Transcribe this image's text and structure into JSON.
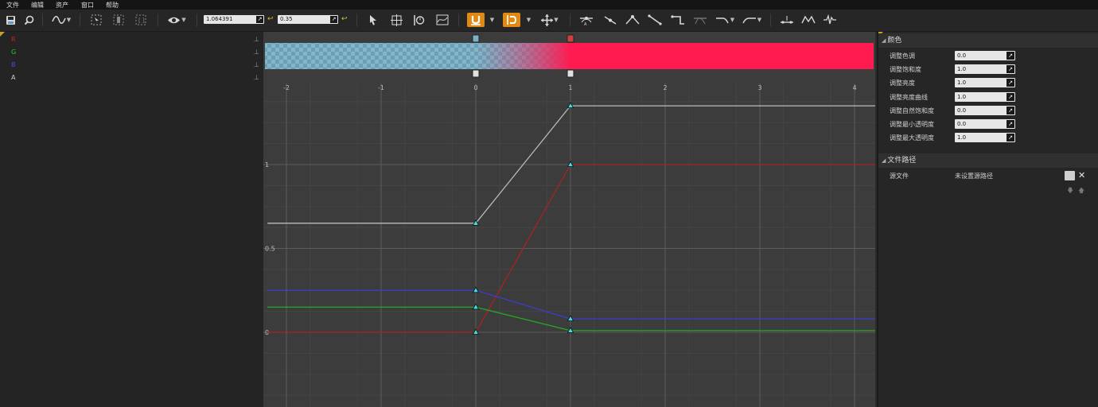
{
  "menu": [
    "文件",
    "编辑",
    "资产",
    "窗口",
    "帮助"
  ],
  "toolbar": {
    "value1": "1.064391",
    "value2": "0.35",
    "icons": [
      "save-icon",
      "browse-icon",
      "curve-mode-icon",
      "zoom-select-icon",
      "zoom-fit-h-icon",
      "zoom-fit-all-icon",
      "eye-icon",
      "pointer-icon",
      "add-key-icon",
      "snap-time-icon",
      "normalize-icon",
      "snap-value-icon",
      "snap-frame-icon",
      "transform-icon",
      "auto-tangent-icon",
      "user-tangent-icon",
      "break-tangent-icon",
      "linear-icon",
      "constant-icon",
      "flatten-icon",
      "pre-infinity-icon",
      "post-infinity-icon",
      "straighten-icon",
      "bake-icon",
      "reduce-icon"
    ]
  },
  "channels": [
    {
      "label": "R",
      "color": "#cc2020"
    },
    {
      "label": "G",
      "color": "#2ccc2c"
    },
    {
      "label": "B",
      "color": "#4a4aee"
    },
    {
      "label": "A",
      "color": "#cfcfcf"
    }
  ],
  "graph": {
    "x_ticks": [
      "-2",
      "-1",
      "0",
      "1",
      "2",
      "3",
      "4"
    ],
    "y_ticks": [
      "1",
      "0.5",
      "0"
    ]
  },
  "chart_data": {
    "type": "line",
    "xlim": [
      -2.1,
      4.25
    ],
    "ylim": [
      -0.45,
      1.4
    ],
    "series": [
      {
        "name": "R",
        "color": "#aa2222",
        "points": [
          [
            -2.2,
            0
          ],
          [
            0,
            0
          ],
          [
            1,
            1
          ],
          [
            4.3,
            1
          ]
        ]
      },
      {
        "name": "G",
        "color": "#22aa22",
        "points": [
          [
            -2.2,
            0.15
          ],
          [
            0,
            0.15
          ],
          [
            1,
            0.01
          ],
          [
            4.3,
            0.01
          ]
        ]
      },
      {
        "name": "B",
        "color": "#3c3ccc",
        "points": [
          [
            -2.2,
            0.25
          ],
          [
            0,
            0.25
          ],
          [
            1,
            0.08
          ],
          [
            4.3,
            0.08
          ]
        ]
      },
      {
        "name": "A",
        "color": "#bbbbbb",
        "points": [
          [
            -2.2,
            0.65
          ],
          [
            0,
            0.65
          ],
          [
            1,
            1.35
          ],
          [
            4.3,
            1.35
          ]
        ]
      }
    ],
    "keys": [
      [
        0,
        0
      ],
      [
        0,
        0.15
      ],
      [
        0,
        0.25
      ],
      [
        0,
        0.65
      ],
      [
        1,
        1
      ],
      [
        1,
        0.01
      ],
      [
        1,
        0.08
      ],
      [
        1,
        1.35
      ]
    ],
    "gradient": {
      "stops": [
        [
          0,
          "#55aacc",
          0.6
        ],
        [
          1,
          "#ff1a50",
          1
        ]
      ]
    }
  },
  "properties": {
    "section_title": "颜色",
    "rows": [
      {
        "label": "调整色调",
        "value": "0.0"
      },
      {
        "label": "调整饱和度",
        "value": "1.0"
      },
      {
        "label": "调整亮度",
        "value": "1.0"
      },
      {
        "label": "调整亮度曲线",
        "value": "1.0"
      },
      {
        "label": "调整自然饱和度",
        "value": "0.0"
      },
      {
        "label": "调整最小透明度",
        "value": "0.0"
      },
      {
        "label": "调整最大透明度",
        "value": "1.0"
      }
    ]
  },
  "filepath": {
    "section_title": "文件路径",
    "label": "源文件",
    "value": "未设置源路径"
  }
}
